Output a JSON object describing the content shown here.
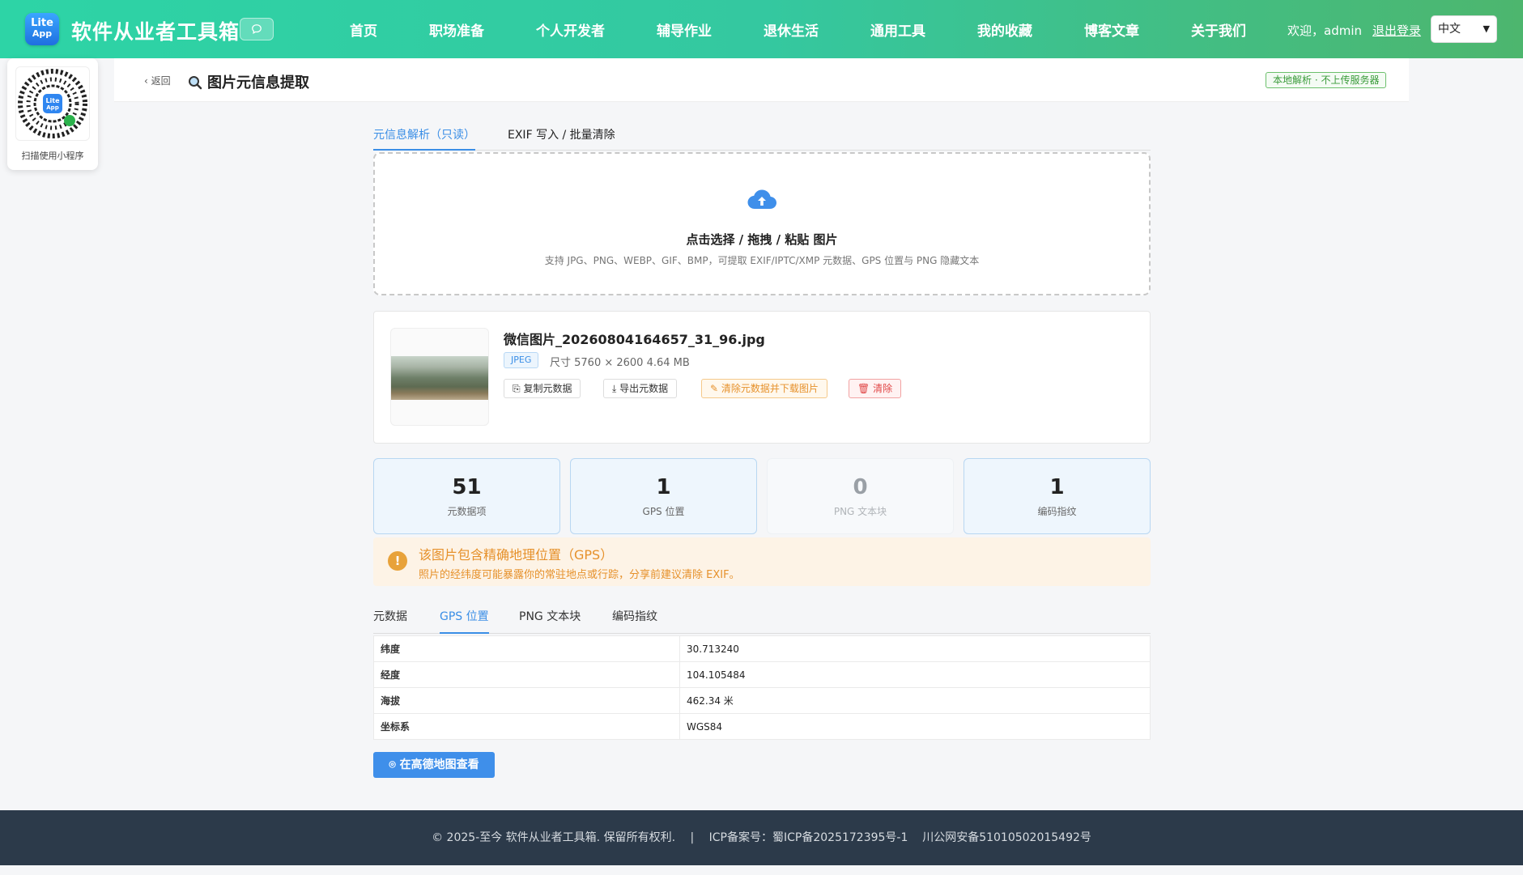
{
  "header": {
    "logo_line1": "Lite",
    "logo_line2": "App",
    "brand": "软件从业者工具箱",
    "chat_icon": "chat-icon",
    "nav": [
      "首页",
      "职场准备",
      "个人开发者",
      "辅导作业",
      "退休生活",
      "通用工具",
      "我的收藏",
      "博客文章",
      "关于我们"
    ],
    "welcome": "欢迎，admin",
    "logout": "退出登录",
    "language": "中文"
  },
  "qr": {
    "logo_line1": "Lite",
    "logo_line2": "App",
    "caption": "扫描使用小程序"
  },
  "page": {
    "back": "返回",
    "title": "图片元信息提取",
    "badge": "本地解析 · 不上传服务器"
  },
  "tabs": [
    "元信息解析（只读）",
    "EXIF 写入 / 批量清除"
  ],
  "dropzone": {
    "main": "点击选择 / 拖拽 / 粘贴 图片",
    "sub": "支持 JPG、PNG、WEBP、GIF、BMP，可提取 EXIF/IPTC/XMP 元数据、GPS 位置与 PNG 隐藏文本"
  },
  "file": {
    "name": "微信图片_20260804164657_31_96.jpg",
    "format": "JPEG",
    "meta": "尺寸 5760 × 2600   4.64 MB",
    "buttons": {
      "copy": "复制元数据",
      "export": "导出元数据",
      "strip": "清除元数据并下载图片",
      "clear": "清除"
    }
  },
  "stats": [
    {
      "value": "51",
      "label": "元数据项"
    },
    {
      "value": "1",
      "label": "GPS 位置"
    },
    {
      "value": "0",
      "label": "PNG 文本块"
    },
    {
      "value": "1",
      "label": "编码指纹"
    }
  ],
  "alert": {
    "title": "该图片包含精确地理位置（GPS）",
    "desc": "照片的经纬度可能暴露你的常驻地点或行踪，分享前建议清除 EXIF。"
  },
  "subtabs": [
    "元数据",
    "GPS 位置",
    "PNG 文本块",
    "编码指纹"
  ],
  "gps": [
    {
      "key": "纬度",
      "value": "30.713240"
    },
    {
      "key": "经度",
      "value": "104.105484"
    },
    {
      "key": "海拔",
      "value": "462.34 米"
    },
    {
      "key": "坐标系",
      "value": "WGS84"
    }
  ],
  "map_button": "在高德地图查看",
  "footer": {
    "copyright": "© 2025-至今 软件从业者工具箱. 保留所有权利.",
    "divider": "|",
    "icp": "ICP备案号：蜀ICP备2025172395号-1",
    "police": "川公网安备51010502015492号"
  },
  "colors": {
    "accent": "#3a8ee6",
    "header_start": "#2dd4a6",
    "header_end": "#4db66e",
    "warn": "#e6912b",
    "danger": "#e04848",
    "footer_bg": "#2c3a4a"
  }
}
